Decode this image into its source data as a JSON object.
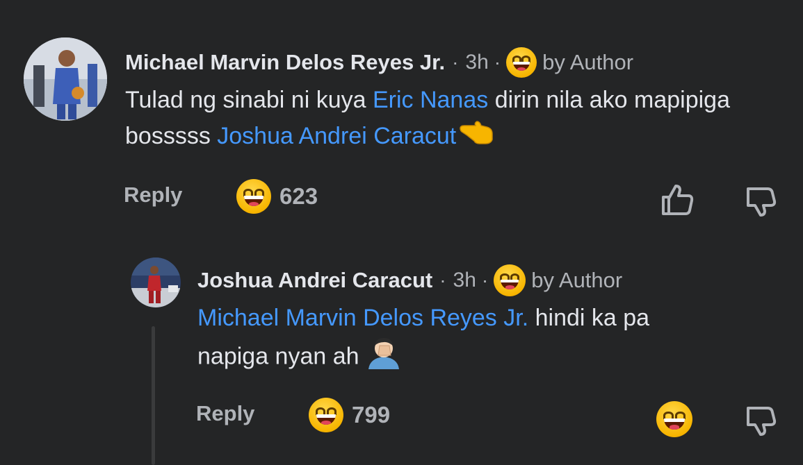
{
  "comment": {
    "author": "Michael Marvin Delos Reyes Jr.",
    "separator1": "·",
    "time": "3h",
    "separator2": "·",
    "badge": "by Author",
    "text_before": "Tulad ng sinabi ni kuya ",
    "mention1": "Eric Nanas",
    "text_middle": " dirin nila ako mapipiga bosssss ",
    "mention2": "Joshua Andrei Caracut",
    "reply_label": "Reply",
    "reaction_count": "623",
    "like_icon": "thumbs-up-icon",
    "dislike_icon": "thumbs-down-icon"
  },
  "reply": {
    "author": "Joshua Andrei Caracut",
    "separator1": "·",
    "time": "3h",
    "separator2": "·",
    "badge": "by Author",
    "mention": "Michael Marvin Delos Reyes Jr.",
    "text_after": " hindi ka pa",
    "text_line2": "napiga nyan ah ",
    "reply_label": "Reply",
    "reaction_count": "799",
    "reacted_icon": "grinning-face-icon",
    "dislike_icon": "thumbs-down-icon"
  },
  "colors": {
    "background": "#242526",
    "text": "#e4e6eb",
    "muted": "#b0b3b8",
    "mention": "#4599ff",
    "emoji": "#f7b500"
  }
}
